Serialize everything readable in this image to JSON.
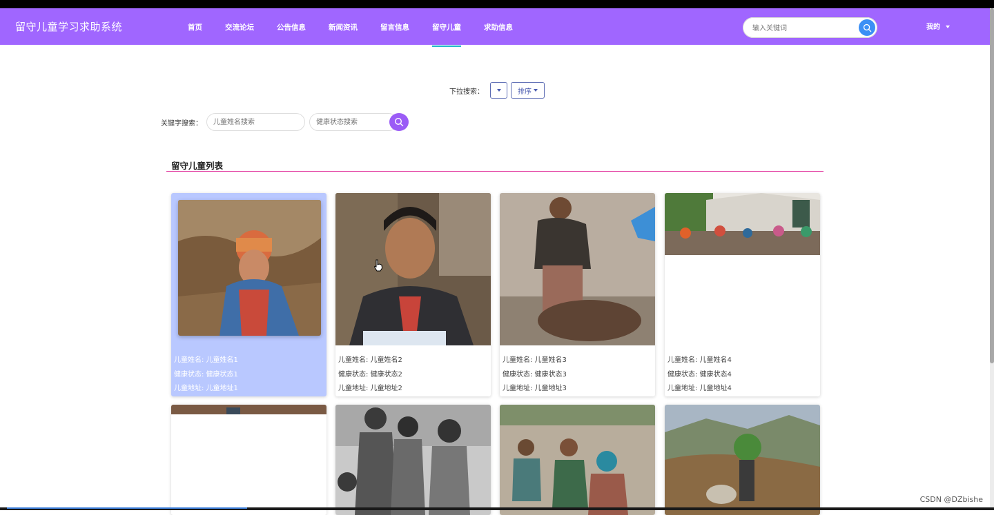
{
  "app": {
    "title": "留守儿童学习求助系统"
  },
  "nav": {
    "items": [
      {
        "label": "首页"
      },
      {
        "label": "交流论坛"
      },
      {
        "label": "公告信息"
      },
      {
        "label": "新闻资讯"
      },
      {
        "label": "留言信息"
      },
      {
        "label": "留守儿童",
        "active": true
      },
      {
        "label": "求助信息"
      }
    ],
    "search_placeholder": "输入关键词",
    "user_menu": "我的"
  },
  "filters": {
    "dropdown_label": "下拉搜索：",
    "sort_label": "排序",
    "keyword_label": "关键字搜索：",
    "name_placeholder": "儿童姓名搜索",
    "health_placeholder": "健康状态搜索"
  },
  "section": {
    "title": "留守儿童列表"
  },
  "children": [
    {
      "name_label": "儿童姓名: 儿童姓名1",
      "health_label": "健康状态: 健康状态1",
      "address_label": "儿童地址: 儿童地址1"
    },
    {
      "name_label": "儿童姓名: 儿童姓名2",
      "health_label": "健康状态: 健康状态2",
      "address_label": "儿童地址: 儿童地址2"
    },
    {
      "name_label": "儿童姓名: 儿童姓名3",
      "health_label": "健康状态: 健康状态3",
      "address_label": "儿童地址: 儿童地址3"
    },
    {
      "name_label": "儿童姓名: 儿童姓名4",
      "health_label": "健康状态: 健康状态4",
      "address_label": "儿童地址: 儿童地址4"
    }
  ],
  "colors": {
    "nav_bg": "#a066ff",
    "accent_line": "#e23aa0",
    "active_card": "#b9c8ff",
    "search_btn": "#3b8ff5",
    "kw_btn": "#9b5cf6"
  },
  "watermark": "CSDN @DZbishe"
}
